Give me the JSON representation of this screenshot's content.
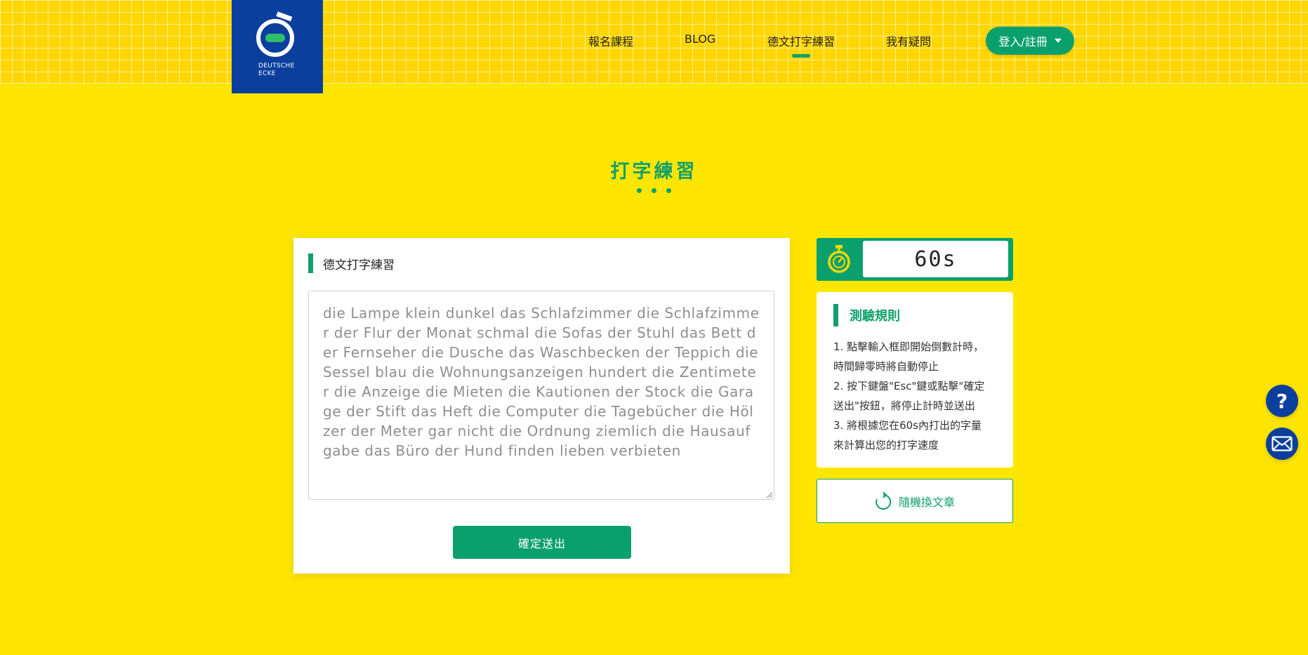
{
  "brand": {
    "logo_text_line1": "DEUTSCHE",
    "logo_text_line2": "ECKE",
    "primary_color": "#0aa06e",
    "brand_blue": "#0b3f9e",
    "background_yellow": "#ffe600"
  },
  "nav": {
    "items": [
      {
        "label": "報名課程",
        "active": false
      },
      {
        "label": "BLOG",
        "active": false
      },
      {
        "label": "德文打字練習",
        "active": true
      },
      {
        "label": "我有疑問",
        "active": false
      }
    ],
    "login_label": "登入/註冊"
  },
  "page": {
    "title": "打字練習"
  },
  "practice": {
    "heading": "德文打字練習",
    "text": "die Lampe klein dunkel das Schlafzimmer die Schlafzimmer der Flur der Monat schmal die Sofas der Stuhl das Bett der Fernseher die Dusche das Waschbecken der Teppich die Sessel blau die Wohnungsanzeigen hundert die Zentimeter die Anzeige die Mieten die Kautionen der Stock die Garage der Stift das Heft die Computer die Tagebücher die Hölzer der Meter gar nicht die Ordnung ziemlich die Hausaufgabe das Büro der Hund finden lieben verbieten",
    "submit_label": "確定送出"
  },
  "timer": {
    "value": "60s",
    "icon": "stopwatch-icon"
  },
  "rules": {
    "heading": "測驗規則",
    "lines": [
      "1. 點擊輸入框即開始倒數計時，",
      "時間歸零時將自動停止",
      "2. 按下鍵盤\"Esc\"鍵或點擊\"確定",
      "送出\"按鈕，將停止計時並送出",
      "3. 將根據您在60s內打出的字量",
      "來計算出您的打字速度"
    ]
  },
  "random_article": {
    "label": "隨機換文章",
    "icon": "refresh-icon"
  },
  "floating": {
    "help_symbol": "?",
    "help_icon": "question-icon",
    "mail_icon": "mail-icon"
  }
}
